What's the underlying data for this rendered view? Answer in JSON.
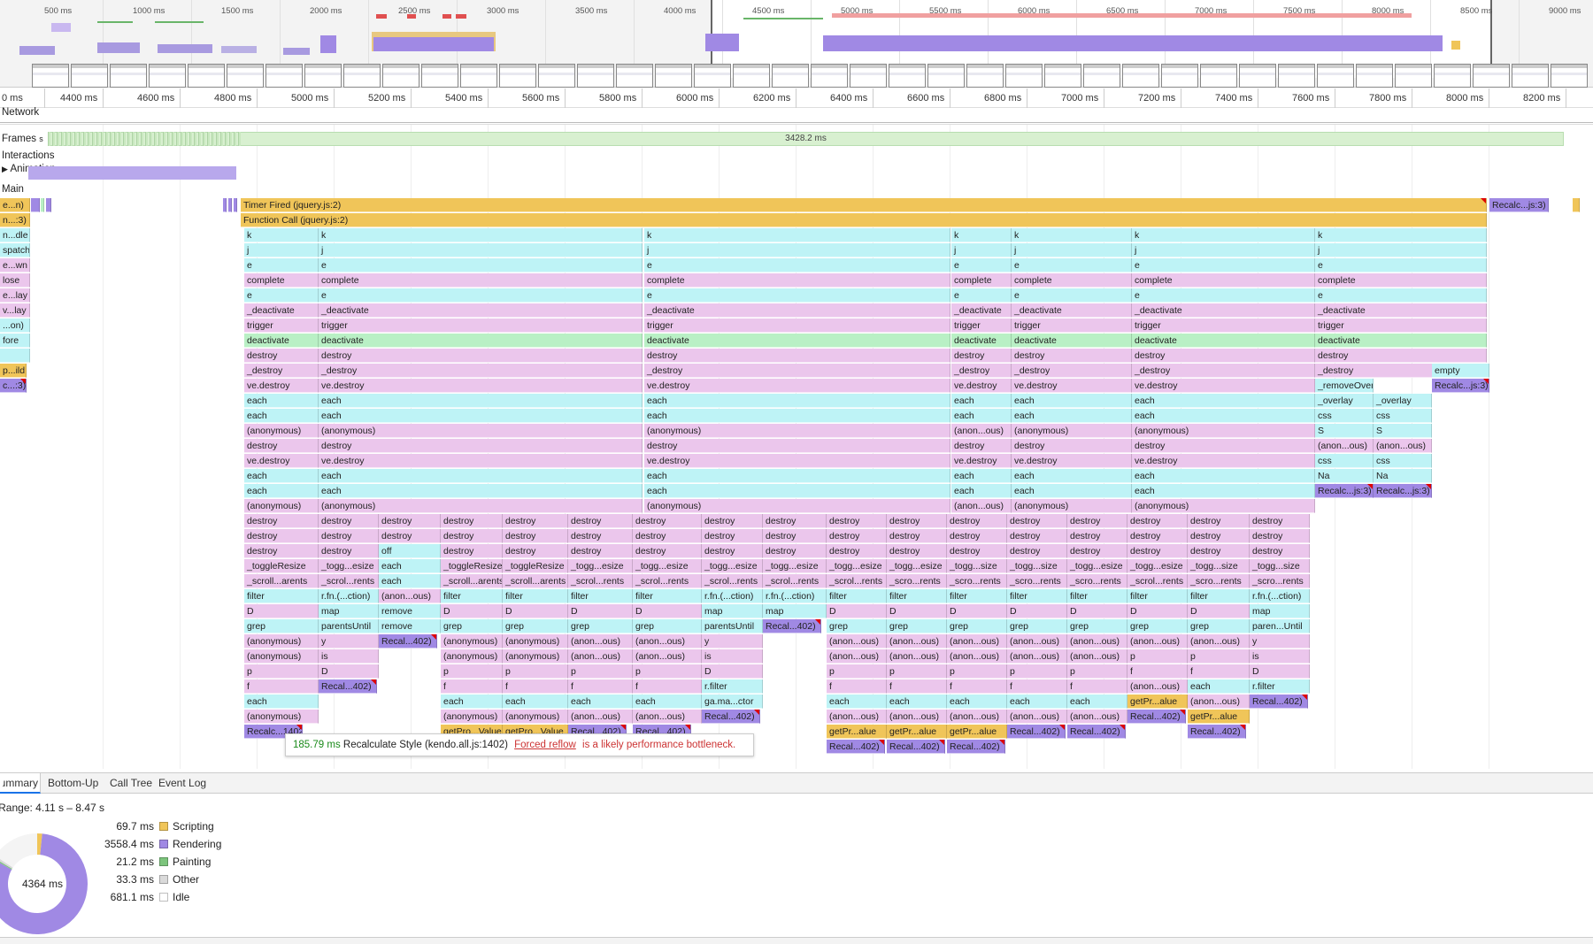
{
  "overview": {
    "ticks": [
      "500 ms",
      "1000 ms",
      "1500 ms",
      "2000 ms",
      "2500 ms",
      "3000 ms",
      "3500 ms",
      "4000 ms",
      "4500 ms",
      "5000 ms",
      "5500 ms",
      "6000 ms",
      "6500 ms",
      "7000 ms",
      "7500 ms",
      "8000 ms",
      "8500 ms",
      "9000 ms"
    ]
  },
  "ruler": {
    "ticks": [
      "0 ms",
      "4400 ms",
      "4600 ms",
      "4800 ms",
      "5000 ms",
      "5200 ms",
      "5400 ms",
      "5600 ms",
      "5800 ms",
      "6000 ms",
      "6200 ms",
      "6400 ms",
      "6600 ms",
      "6800 ms",
      "7000 ms",
      "7200 ms",
      "7400 ms",
      "7600 ms",
      "7800 ms",
      "8000 ms",
      "8200 ms"
    ]
  },
  "tracks": {
    "network": "Network",
    "frames": "Frames",
    "frames_suffix": "s",
    "frames_duration": "3428.2 ms",
    "interactions": "Interactions",
    "animation": "Animation",
    "main": "Main"
  },
  "left_stack": [
    "e...n)",
    "n...:3)",
    "n...dle",
    "spatch",
    "e...wn",
    "lose",
    "e...lay",
    "v...lay",
    "...on)",
    "fore",
    "",
    "p...ild",
    "c...:3)"
  ],
  "flame": {
    "timer_fired": "Timer Fired (jquery.js:2)",
    "function_call": "Function Call (jquery.js:2)",
    "recalc_right": "Recalc...js:3)",
    "cols": [
      [
        "k",
        "j",
        "e",
        "complete",
        "e",
        "_deactivate",
        "trigger",
        "deactivate",
        "destroy",
        "_destroy",
        "ve.destroy",
        "each",
        "each",
        "(anonymous)",
        "destroy",
        "ve.destroy",
        "each",
        "each",
        "(anonymous)"
      ],
      [
        "k",
        "j",
        "e",
        "complete",
        "e",
        "_deactivate",
        "trigger",
        "deactivate",
        "destroy",
        "_destroy",
        "ve.destroy",
        "each",
        "each",
        "(anonymous)",
        "destroy",
        "ve.destroy",
        "each",
        "each",
        "(anonymous)"
      ],
      [
        "k",
        "j",
        "e",
        "complete",
        "e",
        "_deactivate",
        "trigger",
        "deactivate",
        "destroy",
        "_destroy",
        "ve.destroy",
        "each",
        "each",
        "(anonymous)",
        "destroy",
        "ve.destroy",
        "each",
        "each",
        "(anonymous)"
      ],
      [
        "k",
        "j",
        "e",
        "complete",
        "e",
        "_deactivate",
        "trigger",
        "deactivate",
        "destroy",
        "_destroy",
        "ve.destroy",
        "each",
        "each",
        "(anon...ous)",
        "destroy",
        "ve.destroy",
        "each",
        "each",
        "(anon...ous)"
      ],
      [
        "k",
        "j",
        "e",
        "complete",
        "e",
        "_deactivate",
        "trigger",
        "deactivate",
        "destroy",
        "_destroy",
        "ve.destroy",
        "each",
        "each",
        "(anonymous)",
        "destroy",
        "ve.destroy",
        "each",
        "each",
        "(anonymous)"
      ],
      [
        "k",
        "j",
        "e",
        "complete",
        "e",
        "_deactivate",
        "trigger",
        "deactivate",
        "destroy",
        "_destroy",
        "ve.destroy",
        "each",
        "each",
        "(anonymous)",
        "destroy",
        "ve.destroy",
        "each",
        "each",
        "(anonymous)"
      ],
      [
        "k",
        "j",
        "e",
        "complete",
        "e",
        "_deactivate",
        "trigger",
        "deactivate",
        "destroy",
        "_destroy",
        "_removeOverlay",
        "_overlay",
        "css",
        "S",
        "(anon...ous)",
        "css",
        "Na",
        "Recalc...js:3)"
      ]
    ],
    "extra": [
      "empty",
      "Recalc...js:3)",
      "_overlay",
      "css",
      "S",
      "(anon...ous)",
      "css",
      "Na",
      "Recalc...js:3)"
    ],
    "subs": [
      [
        "destroy",
        "destroy",
        "destroy",
        "_toggleResize",
        "_scroll...arents",
        "filter",
        "D",
        "grep",
        "(anonymous)",
        "(anonymous)",
        "p",
        "f",
        "each",
        "(anonymous)",
        "Recalc...1402)"
      ],
      [
        "destroy",
        "destroy",
        "destroy",
        "_togg...esize",
        "_scrol...rents",
        "r.fn.(...ction)",
        "map",
        "parentsUntil",
        "y",
        "is",
        "D",
        "Recal...402)"
      ],
      [
        "destroy",
        "destroy",
        "off",
        "each",
        "each",
        "(anon...ous)",
        "remove",
        "remove",
        "Recal...402)"
      ],
      [
        "destroy",
        "destroy",
        "destroy",
        "_toggleResize",
        "_scroll...arents",
        "filter",
        "D",
        "grep",
        "(anonymous)",
        "(anonymous)",
        "p",
        "f",
        "each",
        "(anonymous)",
        "getPro...Value"
      ],
      [
        "destroy",
        "destroy",
        "destroy",
        "_toggleResize",
        "_scroll...arents",
        "filter",
        "D",
        "grep",
        "(anonymous)",
        "(anonymous)",
        "p",
        "f",
        "each",
        "(anonymous)",
        "getPro...Value"
      ],
      [
        "destroy",
        "destroy",
        "destroy",
        "_togg...esize",
        "_scrol...rents",
        "filter",
        "D",
        "grep",
        "(anon...ous)",
        "(anon...ous)",
        "p",
        "f",
        "each",
        "(anon...ous)",
        "Recal...402)"
      ],
      [
        "destroy",
        "destroy",
        "destroy",
        "_togg...esize",
        "_scrol...rents",
        "filter",
        "D",
        "grep",
        "(anon...ous)",
        "(anon...ous)",
        "p",
        "f",
        "each",
        "(anon...ous)",
        "Recal...402)"
      ],
      [
        "destroy",
        "destroy",
        "destroy",
        "_togg...esize",
        "_scrol...rents",
        "r.fn.(...ction)",
        "map",
        "parentsUntil",
        "y",
        "is",
        "D",
        "r.filter",
        "ga.ma...ctor",
        "Recal...402)"
      ],
      [
        "destroy",
        "destroy",
        "destroy",
        "_togg...esize",
        "_scrol...rents",
        "r.fn.(...ction)",
        "map",
        "Recal...402)"
      ],
      [
        "destroy",
        "destroy",
        "destroy",
        "_togg...esize",
        "_scrol...rents",
        "filter",
        "D",
        "grep",
        "(anon...ous)",
        "(anon...ous)",
        "p",
        "f",
        "each",
        "(anon...ous)",
        "getPr...alue",
        "Recal...402)"
      ],
      [
        "destroy",
        "destroy",
        "destroy",
        "_togg...esize",
        "_scro...rents",
        "filter",
        "D",
        "grep",
        "(anon...ous)",
        "(anon...ous)",
        "p",
        "f",
        "each",
        "(anon...ous)",
        "getPr...alue",
        "Recal...402)"
      ],
      [
        "destroy",
        "destroy",
        "destroy",
        "_togg...size",
        "_scro...rents",
        "filter",
        "D",
        "grep",
        "(anon...ous)",
        "(anon...ous)",
        "p",
        "f",
        "each",
        "(anon...ous)",
        "getPr...alue",
        "Recal...402)"
      ],
      [
        "destroy",
        "destroy",
        "destroy",
        "_togg...size",
        "_scro...rents",
        "filter",
        "D",
        "grep",
        "(anon...ous)",
        "(anon...ous)",
        "p",
        "f",
        "each",
        "(anon...ous)",
        "Recal...402)"
      ],
      [
        "destroy",
        "destroy",
        "destroy",
        "_togg...esize",
        "_scro...rents",
        "filter",
        "D",
        "grep",
        "(anon...ous)",
        "(anon...ous)",
        "p",
        "f",
        "each",
        "(anon...ous)",
        "Recal...402)"
      ],
      [
        "destroy",
        "destroy",
        "destroy",
        "_togg...esize",
        "_scrol...rents",
        "filter",
        "D",
        "grep",
        "(anon...ous)",
        "p",
        "f",
        "(anon...ous)",
        "getPr...alue",
        "Recal...402)"
      ],
      [
        "destroy",
        "destroy",
        "destroy",
        "_togg...size",
        "_scro...rents",
        "filter",
        "D",
        "grep",
        "(anon...ous)",
        "p",
        "f",
        "each",
        "(anon...ous)",
        "getPr...alue",
        "Recal...402)"
      ],
      [
        "destroy",
        "destroy",
        "destroy",
        "_togg...size",
        "_scro...rents",
        "r.fn.(...ction)",
        "map",
        "paren...Until",
        "y",
        "is",
        "D",
        "r.filter",
        "Recal...402)"
      ]
    ]
  },
  "tooltip": {
    "duration": "185.79 ms",
    "name": "Recalculate Style (kendo.all.js:1402)",
    "link": "Forced reflow",
    "warning": "is a likely performance bottleneck."
  },
  "tabs": [
    "Summary",
    "Bottom-Up",
    "Call Tree",
    "Event Log"
  ],
  "summary": {
    "range": "Range: 4.11 s – 8.47 s",
    "total": "4364 ms",
    "legend": [
      {
        "value": "69.7 ms",
        "label": "Scripting",
        "color": "#f0c559"
      },
      {
        "value": "3558.4 ms",
        "label": "Rendering",
        "color": "#a089e4"
      },
      {
        "value": "21.2 ms",
        "label": "Painting",
        "color": "#7cc47c"
      },
      {
        "value": "33.3 ms",
        "label": "Other",
        "color": "#dadada"
      },
      {
        "value": "681.1 ms",
        "label": "Idle",
        "color": "#ffffff"
      }
    ]
  }
}
